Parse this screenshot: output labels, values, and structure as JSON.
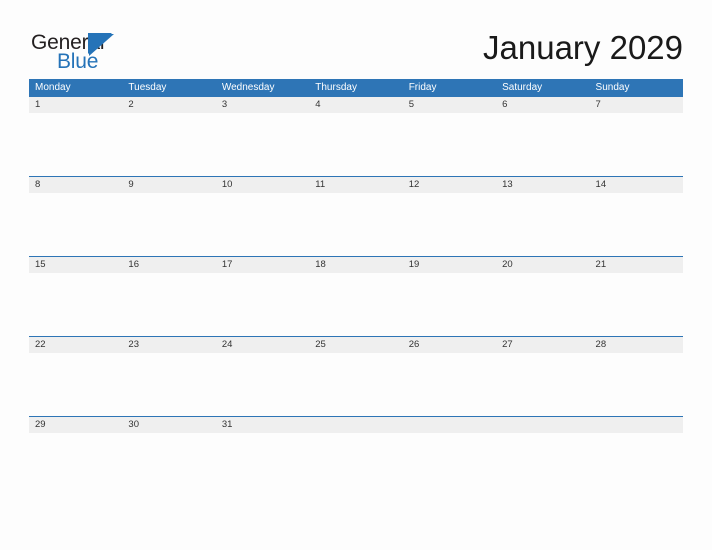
{
  "brand": {
    "name_part1": "General",
    "name_part2": "Blue",
    "flag_icon": "blue-triangle-flag",
    "accent_color": "#2573b8"
  },
  "header": {
    "title": "January 2029"
  },
  "calendar": {
    "header_color": "#2e75b6",
    "date_band_color": "#efefef",
    "weekdays": [
      "Monday",
      "Tuesday",
      "Wednesday",
      "Thursday",
      "Friday",
      "Saturday",
      "Sunday"
    ],
    "weeks": [
      [
        "1",
        "2",
        "3",
        "4",
        "5",
        "6",
        "7"
      ],
      [
        "8",
        "9",
        "10",
        "11",
        "12",
        "13",
        "14"
      ],
      [
        "15",
        "16",
        "17",
        "18",
        "19",
        "20",
        "21"
      ],
      [
        "22",
        "23",
        "24",
        "25",
        "26",
        "27",
        "28"
      ],
      [
        "29",
        "30",
        "31",
        "",
        "",
        "",
        ""
      ]
    ]
  }
}
